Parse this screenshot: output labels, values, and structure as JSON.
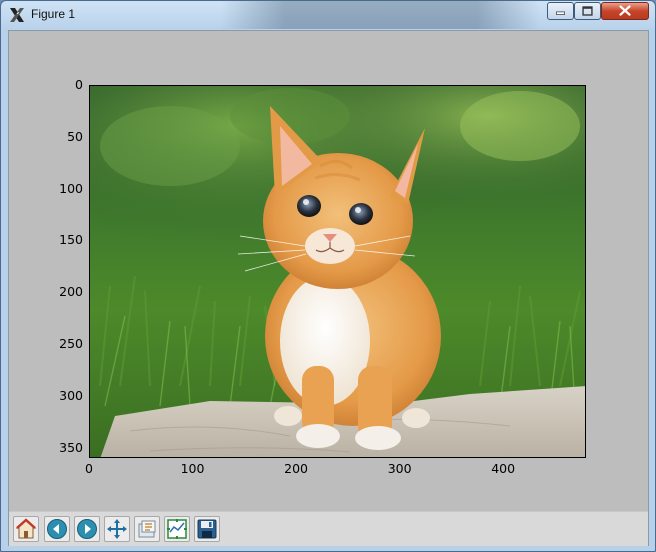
{
  "window": {
    "title": "Figure 1"
  },
  "figure": {
    "y_ticks": [
      "0",
      "50",
      "100",
      "150",
      "200",
      "250",
      "300",
      "350"
    ],
    "x_ticks": [
      "0",
      "100",
      "200",
      "300",
      "400"
    ]
  },
  "toolbar": {
    "buttons": [
      {
        "name": "home",
        "icon": "home-icon"
      },
      {
        "name": "back",
        "icon": "back-arrow-icon"
      },
      {
        "name": "forward",
        "icon": "forward-arrow-icon"
      },
      {
        "name": "pan",
        "icon": "pan-icon"
      },
      {
        "name": "zoom",
        "icon": "zoom-icon"
      },
      {
        "name": "configure-subplots",
        "icon": "subplots-icon"
      },
      {
        "name": "save",
        "icon": "save-icon"
      }
    ]
  },
  "colors": {
    "figure_bg": "#bdbdbd",
    "toolbar_bg": "#d9d9d9",
    "grass": "#4f8a2a",
    "kitten": "#e6a04e"
  }
}
